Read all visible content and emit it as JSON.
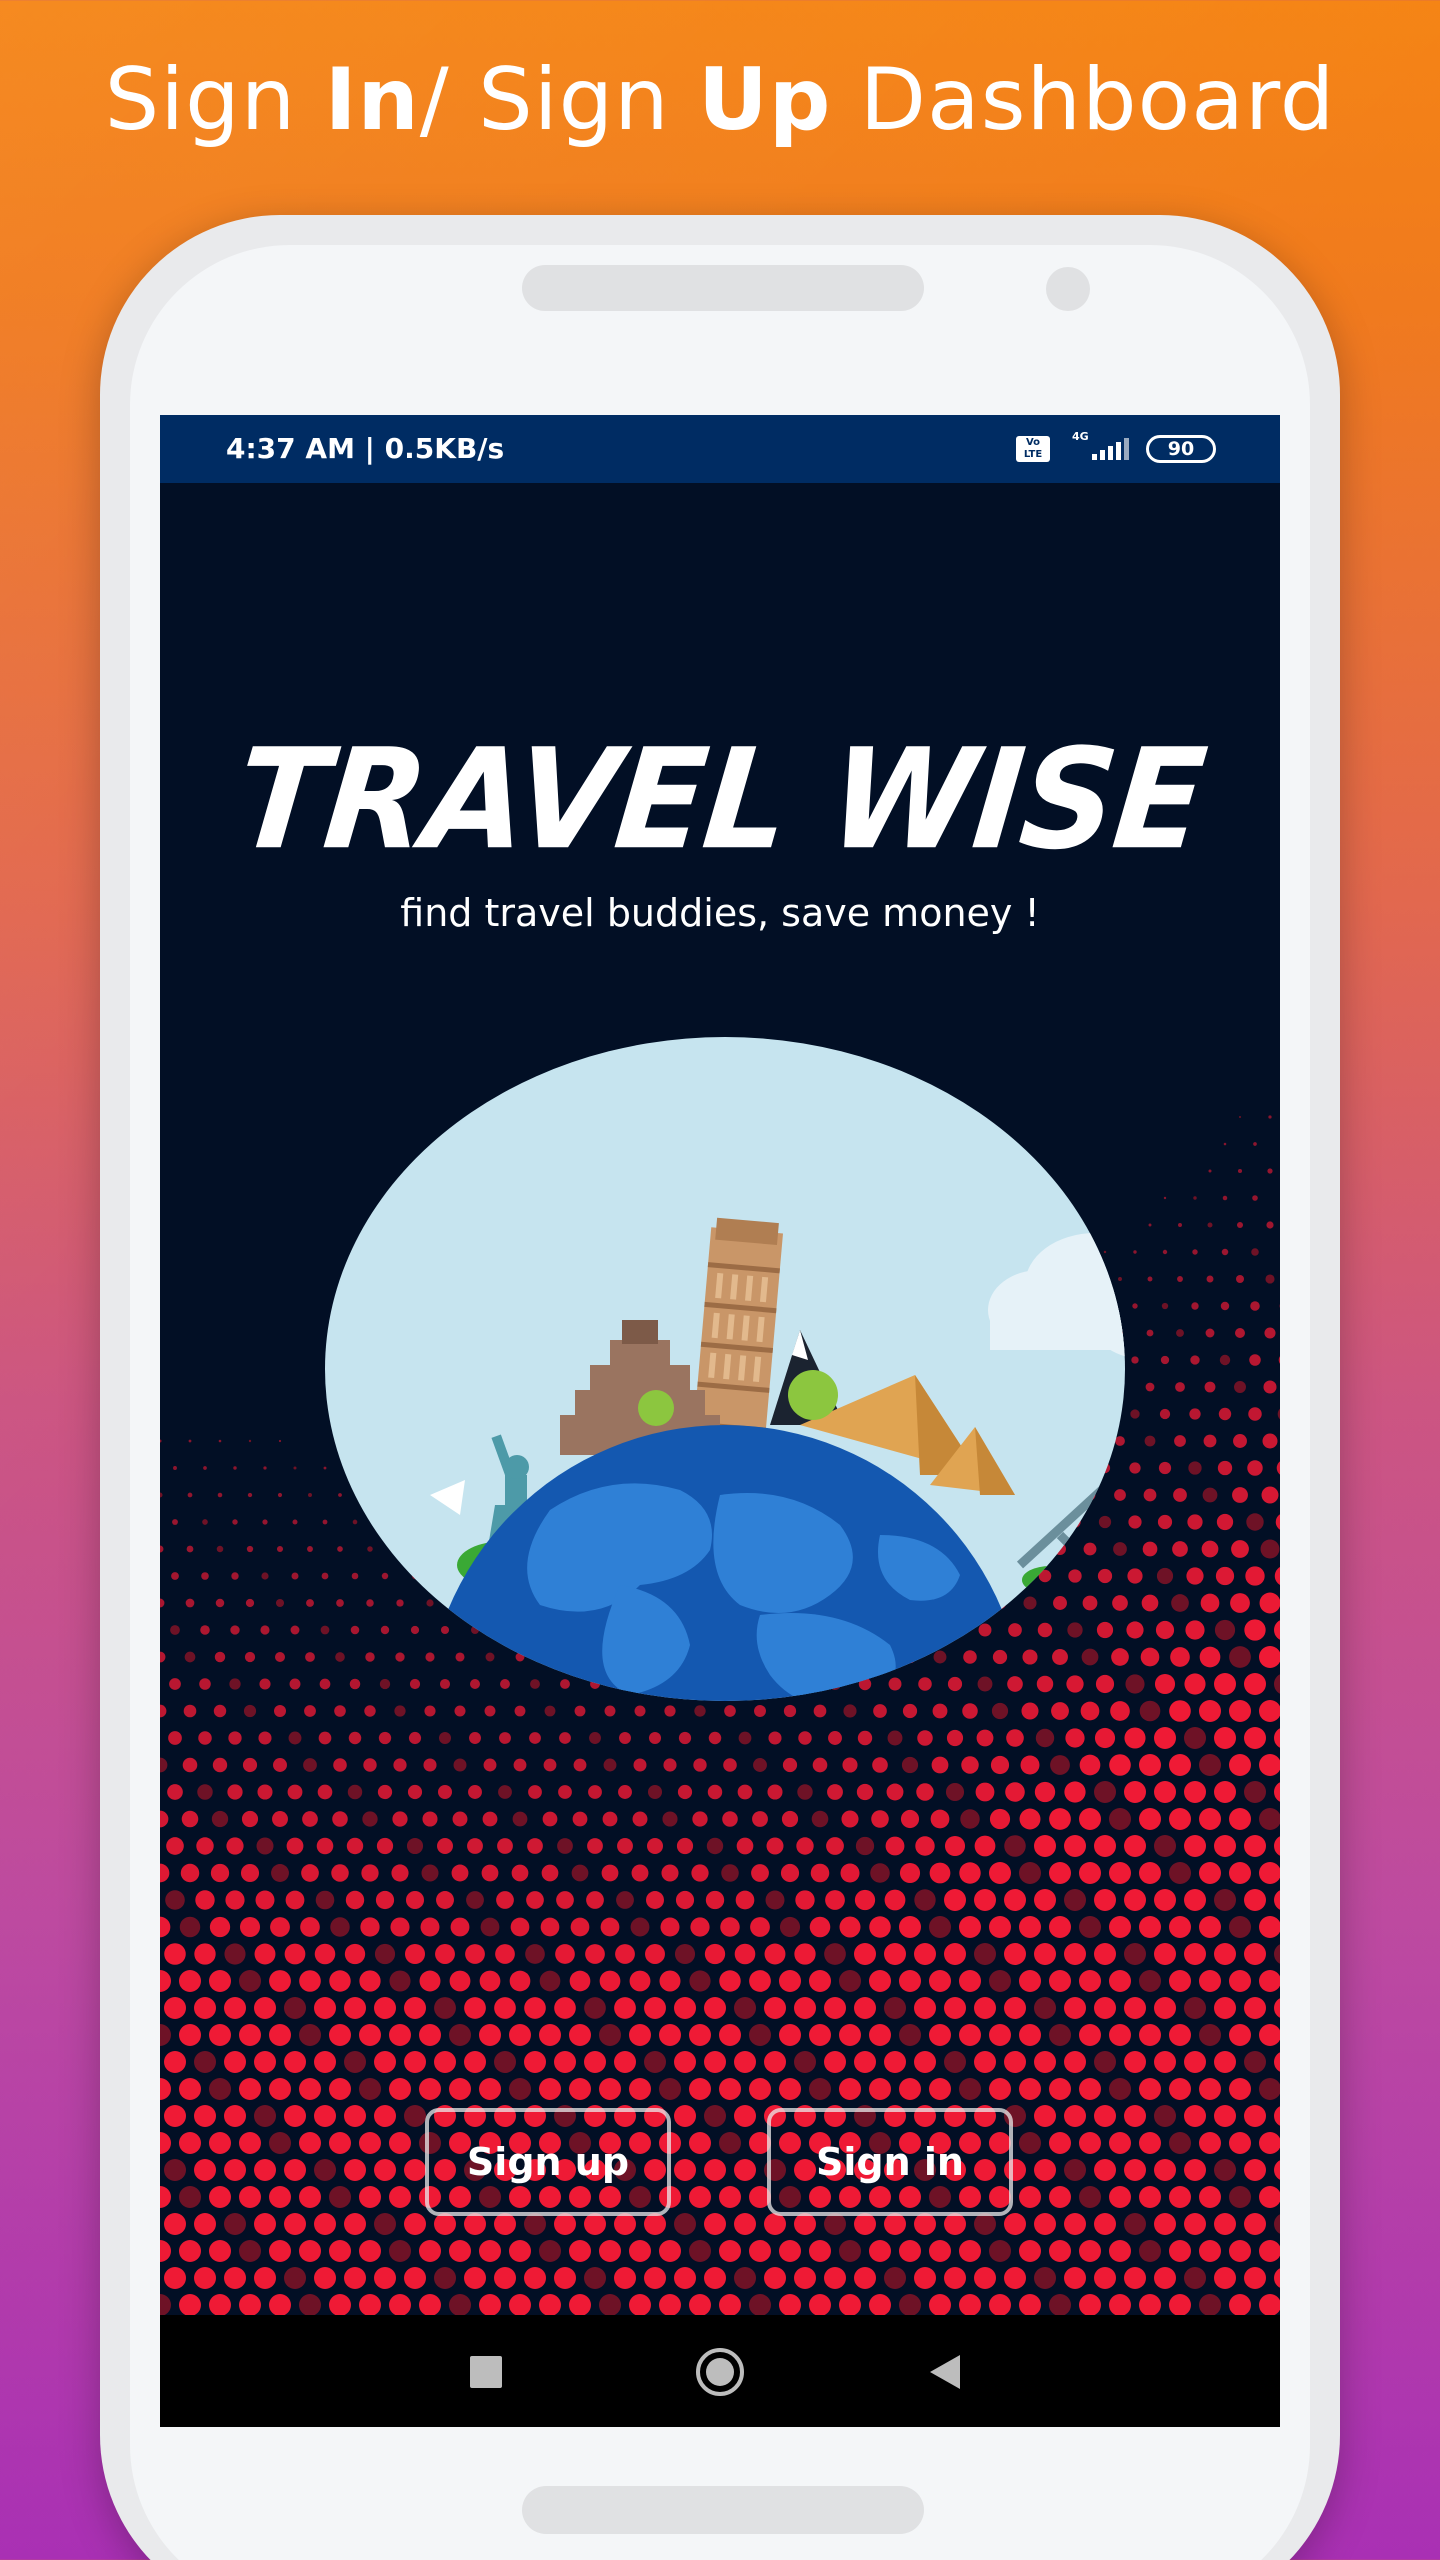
{
  "page": {
    "headline_parts": [
      "Sign ",
      "In",
      "/ Sign ",
      "Up",
      " Dashboard"
    ]
  },
  "status_bar": {
    "time": "4:37 AM | 0.5KB/s",
    "volte_label": "Vo\nLTE",
    "network_label": "4G",
    "battery": "90",
    "icons": [
      "volte-icon",
      "signal-icon",
      "battery-icon"
    ]
  },
  "app": {
    "title": "TRAVEL WISE",
    "tagline": "find travel buddies, save money !"
  },
  "actions": {
    "sign_up_label": "Sign up",
    "sign_in_label": "Sign in"
  },
  "nav_bar": {
    "icons": [
      "recents-square-icon",
      "home-circle-icon",
      "back-triangle-icon"
    ]
  },
  "colors": {
    "status_bar": "#002c63",
    "screen_bg": "#020f25",
    "dot_red": "#ef1a35",
    "globe_blue": "#1565c0",
    "sky": "#c6e4ef"
  }
}
